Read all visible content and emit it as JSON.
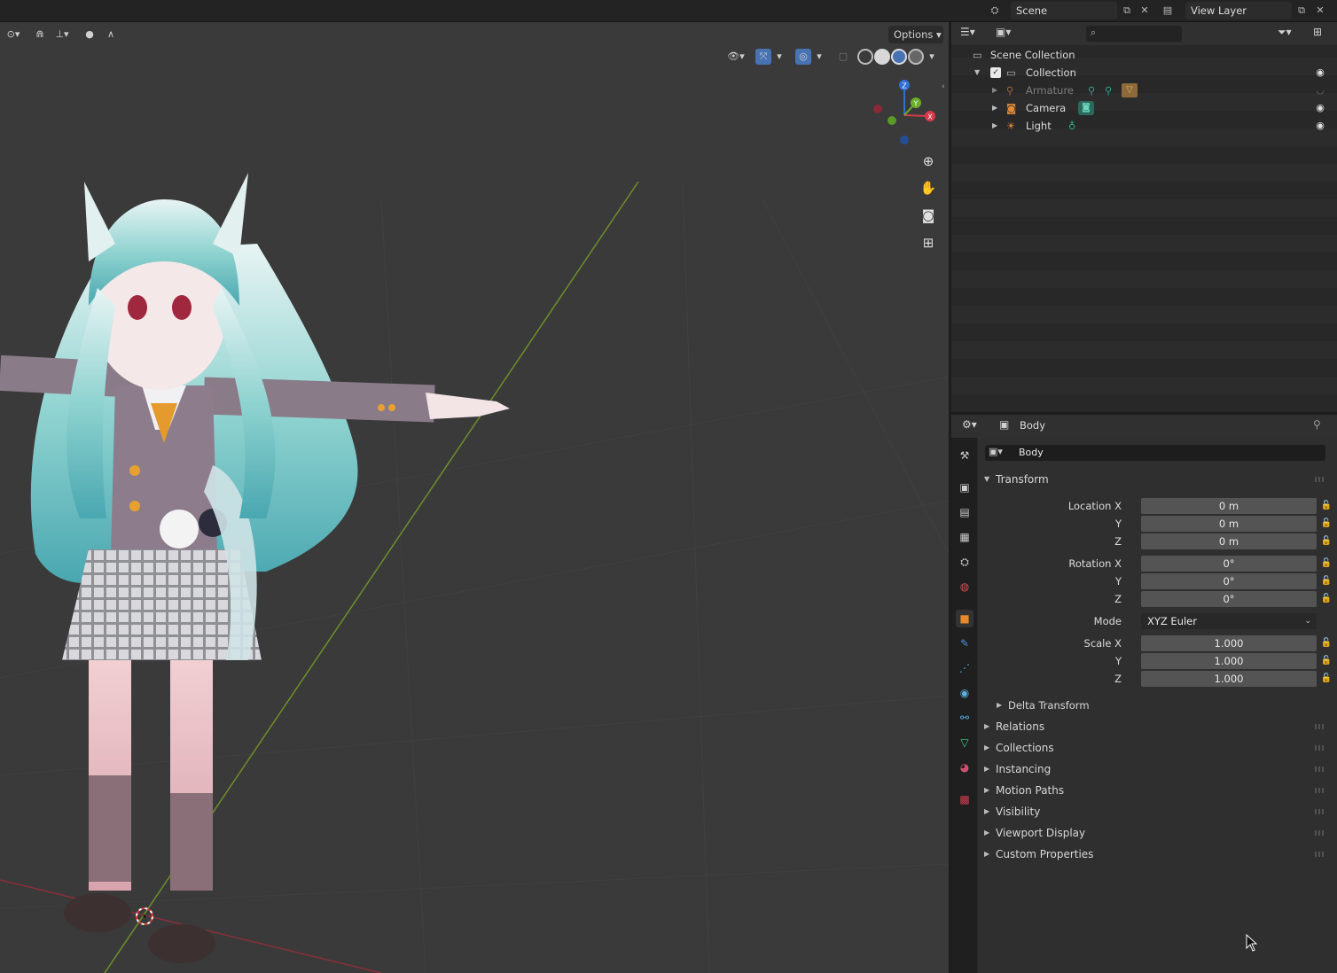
{
  "colors": {
    "accent_blue": "#4772b3",
    "axis_x": "#d93a4a",
    "axis_y": "#6cad2a",
    "axis_z": "#2f6fd6",
    "object_orange": "#e8882a"
  },
  "topbar": {
    "scene_icon": "scene-icon",
    "scene_name": "Scene",
    "view_layer_icon": "view-layer-icon",
    "view_layer_name": "View Layer"
  },
  "viewport": {
    "options_label": "Options",
    "gizmo": {
      "x_label": "X",
      "y_label": "Y",
      "z_label": "Z"
    }
  },
  "outliner": {
    "search_placeholder": "",
    "rows": [
      {
        "label": "Scene Collection"
      },
      {
        "label": "Collection"
      },
      {
        "label": "Armature"
      },
      {
        "label": "Camera"
      },
      {
        "label": "Light"
      }
    ]
  },
  "properties": {
    "context_label": "Body",
    "object_name": "Body",
    "transform": {
      "title": "Transform",
      "location_label": "Location X",
      "location": [
        "0 m",
        "0 m",
        "0 m"
      ],
      "rotation_label": "Rotation X",
      "rotation": [
        "0°",
        "0°",
        "0°"
      ],
      "mode_label": "Mode",
      "mode_value": "XYZ Euler",
      "scale_label": "Scale X",
      "scale": [
        "1.000",
        "1.000",
        "1.000"
      ],
      "y_label": "Y",
      "z_label": "Z",
      "delta": "Delta Transform"
    },
    "panels": [
      "Relations",
      "Collections",
      "Instancing",
      "Motion Paths",
      "Visibility",
      "Viewport Display",
      "Custom Properties"
    ]
  }
}
